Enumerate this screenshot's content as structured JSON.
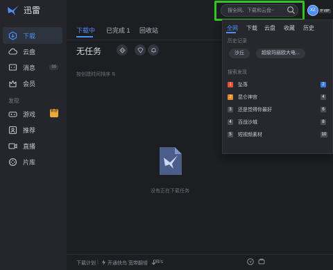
{
  "app": {
    "title": "迅雷"
  },
  "sidebar": {
    "items": [
      {
        "label": "下载",
        "icon": "download-icon",
        "active": true
      },
      {
        "label": "云盘",
        "icon": "cloud-icon"
      },
      {
        "label": "消息",
        "icon": "message-icon",
        "badge": "99"
      },
      {
        "label": "会员",
        "icon": "vip-icon"
      }
    ],
    "discover_heading": "发现",
    "discover_items": [
      {
        "label": "游戏",
        "icon": "gamepad-icon",
        "badge": "新游"
      },
      {
        "label": "推荐",
        "icon": "recommend-icon"
      },
      {
        "label": "直播",
        "icon": "live-icon"
      },
      {
        "label": "片库",
        "icon": "film-icon"
      }
    ]
  },
  "main": {
    "tabs": [
      "下载中",
      "已完成 1",
      "回收站"
    ],
    "no_task": "无任务",
    "sort_label": "按创建时间排序 ⇅",
    "empty_text": "没有正在下载任务"
  },
  "footer": {
    "plan": "下载计划",
    "speedup": "开通快鸟 宽带翻倍",
    "speed": "0B/s"
  },
  "search": {
    "placeholder": "搜全网、下载和云盘~",
    "user_initials": "XZ",
    "user_tag": "P VIP"
  },
  "dropdown": {
    "tabs": [
      "全网",
      "下载",
      "云盘",
      "收藏",
      "历史"
    ],
    "history_heading": "历史记录",
    "history": [
      "沙丘",
      "超级玛丽欧大电..."
    ],
    "hot_heading": "搜索发现",
    "hot": [
      {
        "rank": "1",
        "label": "坠落",
        "color": "#e0503a"
      },
      {
        "rank": "2",
        "label": "昆仑神宫",
        "color": "#e58a2c"
      },
      {
        "rank": "3",
        "label": "还是觉得你最好",
        "color": "#4a4d55"
      },
      {
        "rank": "4",
        "label": "百战沙城",
        "color": "#4a4d55"
      },
      {
        "rank": "5",
        "label": "短视频素材",
        "color": "#4a4d55"
      }
    ],
    "hot_right_ranks": [
      "2",
      "4",
      "6",
      "8",
      "10"
    ]
  },
  "colors": {
    "accent": "#4f8df7",
    "highlight": "#32c61c",
    "background": "#1d1e22",
    "sidebar": "#24262b"
  }
}
